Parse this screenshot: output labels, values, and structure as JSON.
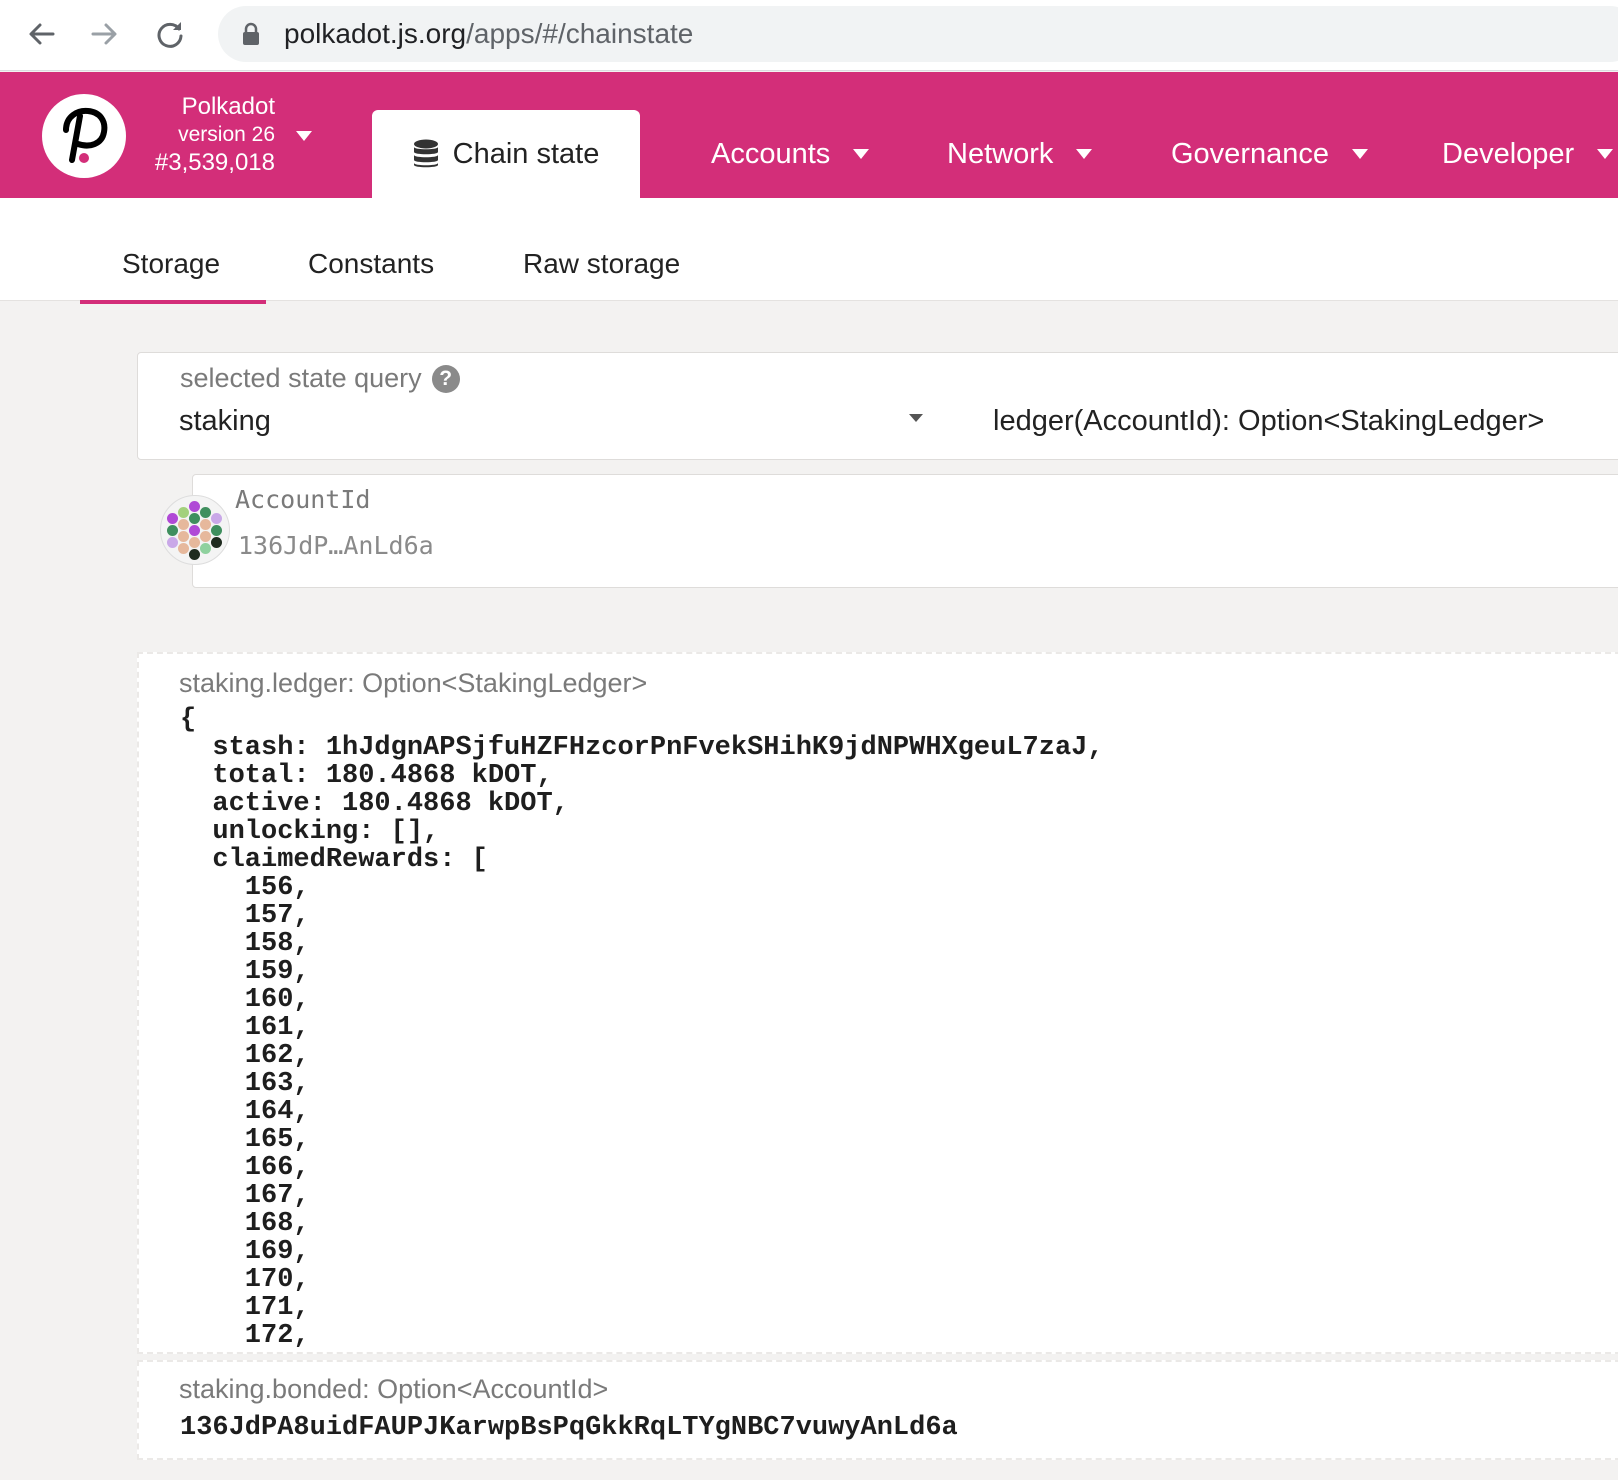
{
  "browser": {
    "url_host": "polkadot.js.org",
    "url_path": "/apps/#/chainstate"
  },
  "header": {
    "chain_name": "Polkadot",
    "version": "version 26",
    "block": "#3,539,018",
    "active_tab": "Chain state",
    "menu": [
      "Accounts",
      "Network",
      "Governance",
      "Developer"
    ],
    "accent_color": "#d32e79"
  },
  "subtabs": [
    "Storage",
    "Constants",
    "Raw storage"
  ],
  "query": {
    "label": "selected state query",
    "module": "staking",
    "method": "ledger(AccountId): Option<StakingLedger>"
  },
  "param": {
    "label": "AccountId",
    "value": "136JdP…AnLd6a"
  },
  "results": {
    "ledger": {
      "title": "staking.ledger: Option<StakingLedger>",
      "lines": [
        "{",
        "  stash: 1hJdgnAPSjfuHZFHzcorPnFvekSHihK9jdNPWHXgeuL7zaJ,",
        "  total: 180.4868 kDOT,",
        "  active: 180.4868 kDOT,",
        "  unlocking: [],",
        "  claimedRewards: [",
        "    156,",
        "    157,",
        "    158,",
        "    159,",
        "    160,",
        "    161,",
        "    162,",
        "    163,",
        "    164,",
        "    165,",
        "    166,",
        "    167,",
        "    168,",
        "    169,",
        "    170,",
        "    171,",
        "    172,"
      ]
    },
    "bonded": {
      "title": "staking.bonded: Option<AccountId>",
      "value": "136JdPA8uidFAUPJKarwpBsPqGkkRqLTYgNBC7vuwyAnLd6a"
    }
  }
}
